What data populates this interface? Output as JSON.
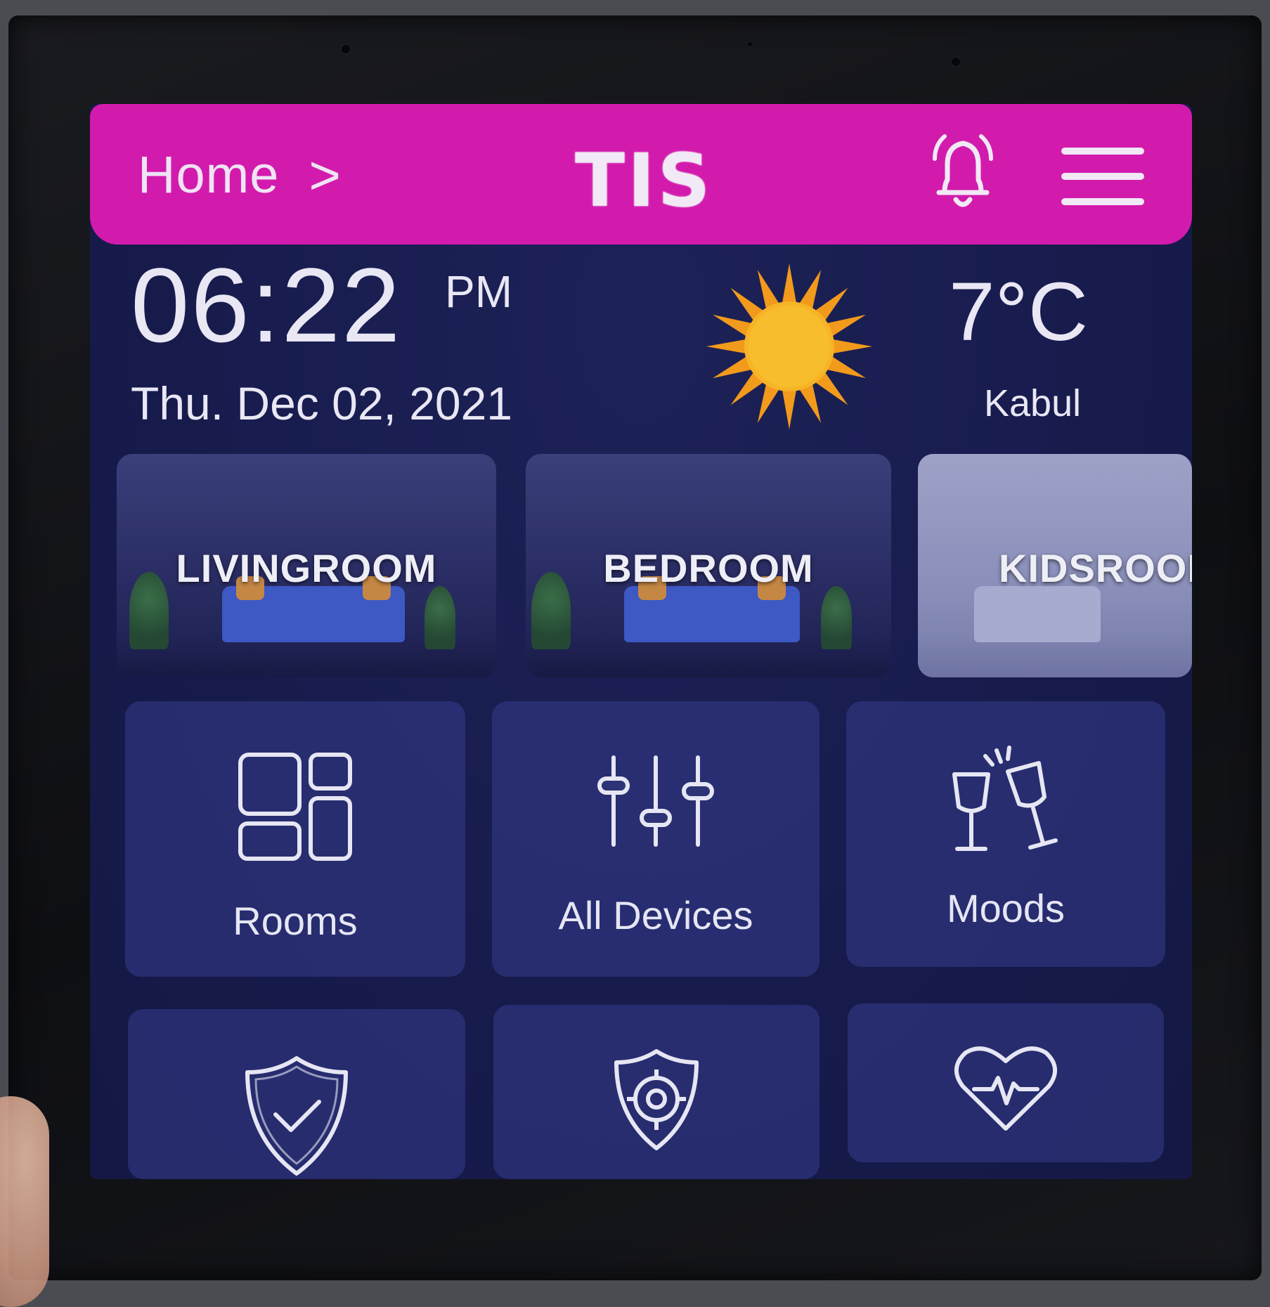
{
  "header": {
    "breadcrumb": "Home",
    "breadcrumb_chevron": ">",
    "logo": "TIS",
    "accent_color": "#d21bad"
  },
  "clock": {
    "time": "06:22",
    "ampm": "PM",
    "date": "Thu. Dec 02, 2021"
  },
  "weather": {
    "icon": "sun-icon",
    "temperature": "7°C",
    "city": "Kabul"
  },
  "rooms": [
    {
      "label": "LIVINGROOM"
    },
    {
      "label": "BEDROOM"
    },
    {
      "label": "KIDSROOM"
    }
  ],
  "tiles": [
    {
      "label": "Rooms",
      "icon": "rooms-grid-icon"
    },
    {
      "label": "All Devices",
      "icon": "sliders-icon"
    },
    {
      "label": "Moods",
      "icon": "toast-glasses-icon"
    },
    {
      "label": "",
      "icon": "shield-check-icon"
    },
    {
      "label": "",
      "icon": "security-shield-icon"
    },
    {
      "label": "",
      "icon": "heart-pulse-icon"
    }
  ]
}
